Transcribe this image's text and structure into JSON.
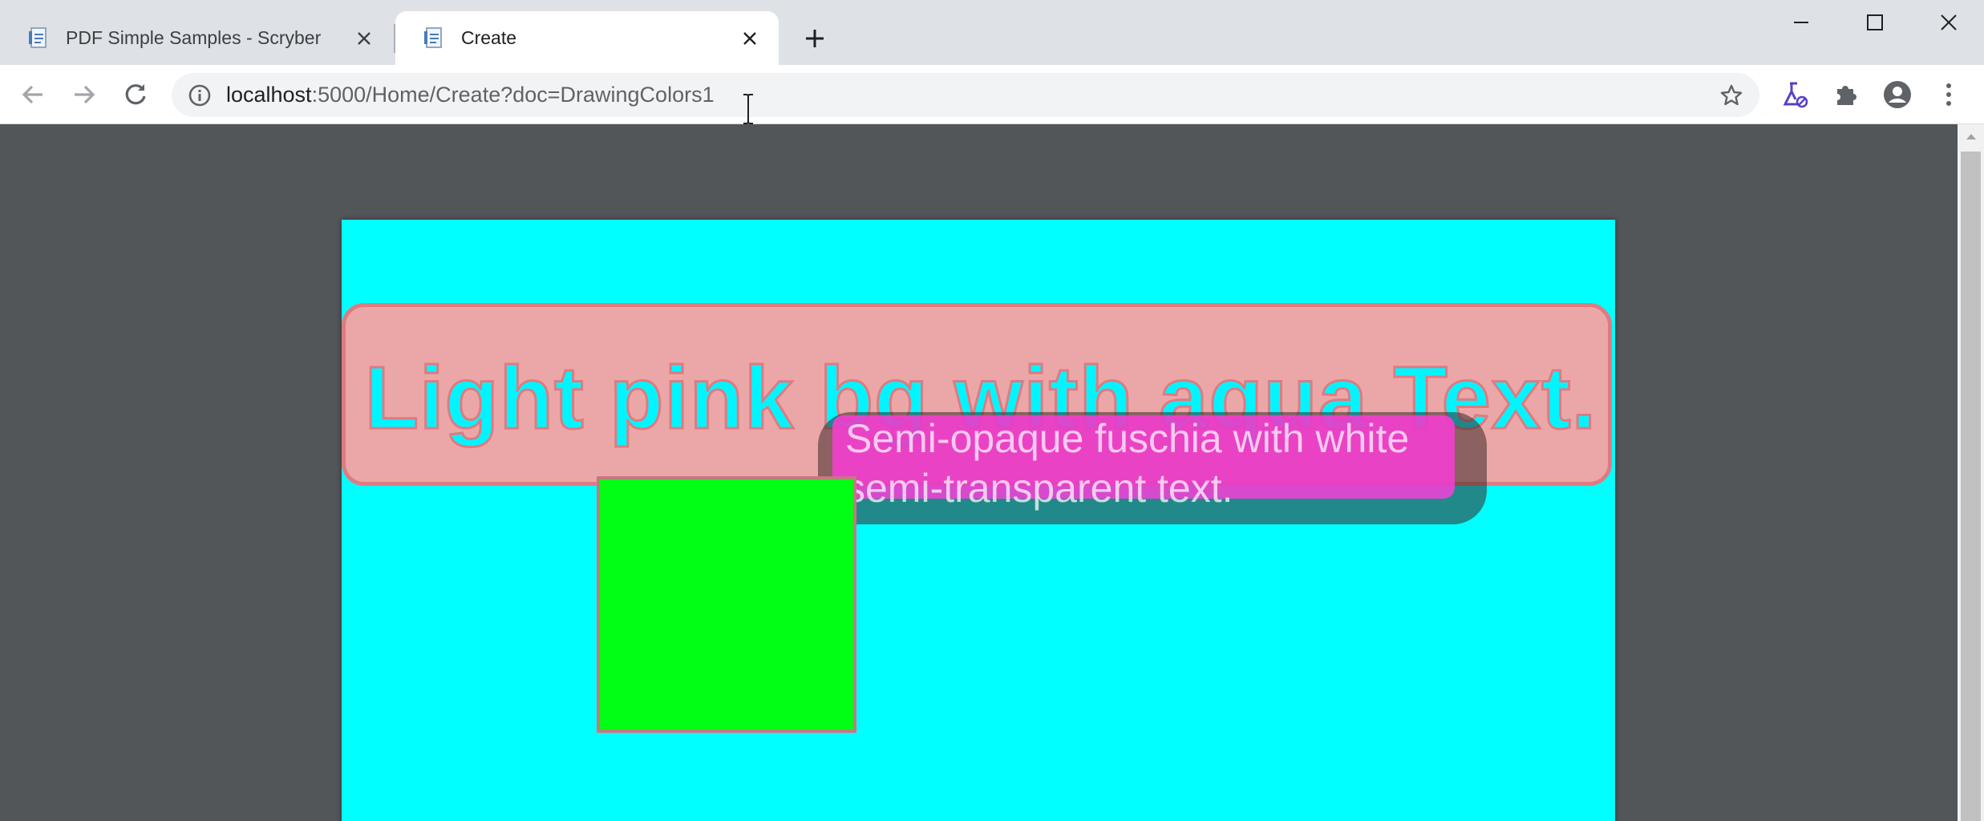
{
  "tabs": [
    {
      "title": "PDF Simple Samples - Scryber",
      "active": false
    },
    {
      "title": "Create",
      "active": true
    }
  ],
  "toolbar": {
    "url_host": "localhost",
    "url_path": ":5000/Home/Create?doc=DrawingColors1"
  },
  "icons": {
    "tab_favicon": "document-icon",
    "tab_close": "close-icon",
    "new_tab": "plus-icon",
    "minimize": "minimize-icon",
    "maximize": "maximize-icon",
    "window_close": "close-icon",
    "back": "back-arrow-icon",
    "forward": "forward-arrow-icon",
    "reload": "reload-icon",
    "site_info": "info-icon",
    "bookmark": "star-icon",
    "labs": "flask-icon",
    "extensions": "puzzle-icon",
    "profile": "account-icon",
    "menu": "kebab-menu-icon"
  },
  "pdf_page": {
    "background_color": "#00ffff",
    "pink_box": {
      "text": "Light pink bg with aqua Text.",
      "background_color": "#ffa0a0",
      "text_color": "#00f5ff",
      "stroke_color": "#e07a80"
    },
    "fuschia_box": {
      "text": "Semi-opaque fuschia with white semi-transparent text.",
      "background_color": "#ff3cdc",
      "text_color": "#ffffff"
    },
    "green_square": {
      "background_color": "#00ff14",
      "border_color": "#c27a80"
    }
  }
}
